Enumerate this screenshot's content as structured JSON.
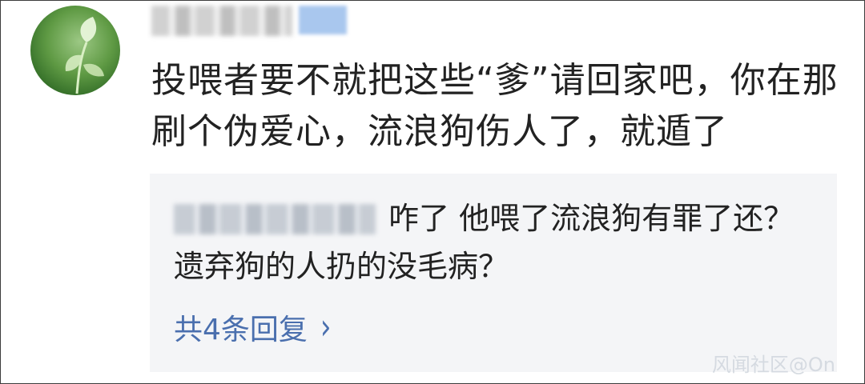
{
  "comment": {
    "avatar_icon": "leaf-avatar-icon",
    "text": "投喂者要不就把这些“爹”请回家吧，你在那刷个伪爱心，流浪狗伤人了，就遁了"
  },
  "reply": {
    "text": "咋了 他喂了流浪狗有罪了还？遗弃狗的人扔的没毛病？",
    "more_replies_label": "共4条回复",
    "chevron_icon": "chevron-right-icon"
  },
  "watermark": "风闻社区@On",
  "colors": {
    "link": "#4a6fae",
    "reply_background": "#f4f5f7",
    "text": "#222222"
  }
}
